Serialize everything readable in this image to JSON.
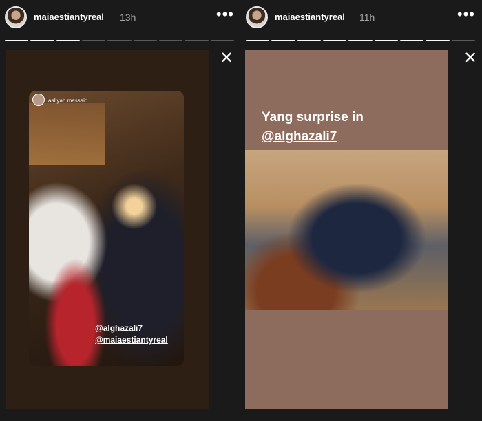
{
  "stories": [
    {
      "username": "maiaestiantyreal",
      "time": "13h",
      "progress_segments": 9,
      "progress_filled": 3,
      "tagged_user": "aaliyah.massaid",
      "mentions": [
        "@alghazali7",
        "@maiaestiantyreal"
      ]
    },
    {
      "username": "maiaestiantyreal",
      "time": "11h",
      "progress_segments": 9,
      "progress_filled": 8,
      "caption_line1": "Yang surprise in",
      "caption_line2": "@alghazali7"
    }
  ],
  "more_icon": "•••",
  "close_icon": "✕"
}
